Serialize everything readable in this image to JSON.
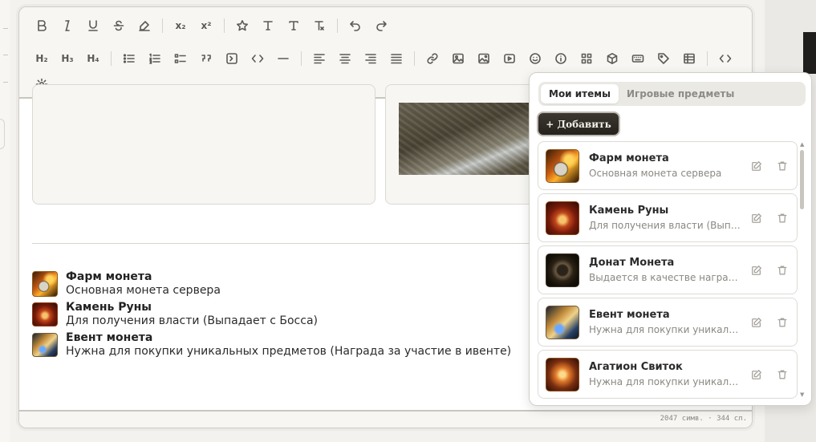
{
  "toolbar": {
    "heading_buttons": [
      "H₂",
      "H₃",
      "H₄"
    ],
    "subscript_label": "x₂",
    "superscript_label": "x²"
  },
  "content": {
    "items": [
      {
        "name": "Фарм монета",
        "description": "Основная монета сервера",
        "icon": "farm-coin-icon"
      },
      {
        "name": "Камень Руны",
        "description": "Для получения власти (Выпадает с Босса)",
        "icon": "rune-stone-icon"
      },
      {
        "name": "Евент монета",
        "description": "Нужна для покупки уникальных предметов (Награда за участие в ивенте)",
        "icon": "event-coin-icon"
      }
    ]
  },
  "status": {
    "counts": "2047 симв. · 344 сл."
  },
  "popup": {
    "tabs": [
      {
        "label": "Мои итемы",
        "active": true
      },
      {
        "label": "Игровые предметы",
        "active": false
      }
    ],
    "add_label": "+ Добавить",
    "items": [
      {
        "name": "Фарм монета",
        "description": "Основная монета сервера",
        "icon": "farm-coin-icon"
      },
      {
        "name": "Камень Руны",
        "description": "Для получения власти (Выпадает с Босса)",
        "icon": "rune-stone-icon"
      },
      {
        "name": "Донат Монета",
        "description": "Выдается в качестве награды за донат",
        "icon": "donate-coin-icon"
      },
      {
        "name": "Евент монета",
        "description": "Нужна для покупки уникальных предметов",
        "icon": "event-coin-icon"
      },
      {
        "name": "Агатион Свиток",
        "description": "Нужна для покупки уникальных предметов",
        "icon": "agathion-scroll-icon"
      }
    ]
  },
  "colors": {
    "accent_dark": "#25221d",
    "border": "#dedbd5",
    "muted_text": "#8a8882"
  }
}
